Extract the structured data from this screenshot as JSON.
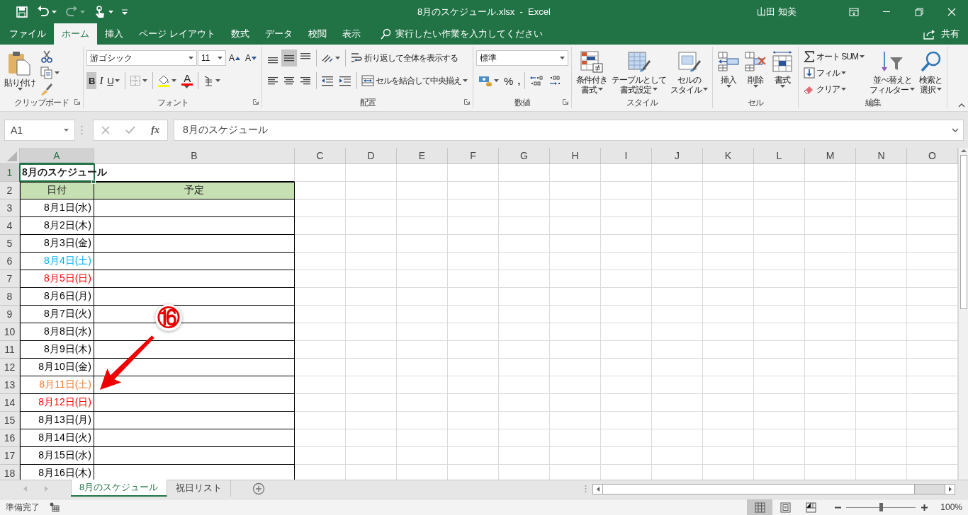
{
  "title_bar": {
    "title": "8月のスケジュール.xlsx  -  Excel",
    "user": "山田 知美"
  },
  "quick_access": [
    {
      "disabled": false
    },
    {
      "disabled": false
    },
    {
      "disabled": true
    },
    {
      "disabled": false
    }
  ],
  "ribbon_tabs": [
    {
      "label": "ファイル",
      "selected": false
    },
    {
      "label": "ホーム",
      "selected": true
    },
    {
      "label": "挿入",
      "selected": false
    },
    {
      "label": "ページ レイアウト",
      "selected": false
    },
    {
      "label": "数式",
      "selected": false
    },
    {
      "label": "データ",
      "selected": false
    },
    {
      "label": "校閲",
      "selected": false
    },
    {
      "label": "表示",
      "selected": false
    }
  ],
  "tell_me": {
    "placeholder": "実行したい作業を入力してください"
  },
  "share": "共有",
  "ribbon_groups": [
    {
      "label": "クリップボード",
      "launcher": true,
      "sections": [
        {
          "kind": "large",
          "lines": [
            "貼り付け"
          ],
          "menu": true
        },
        {
          "kind": "column",
          "items": [
            {
              "kind": "button",
              "menu": false
            },
            {
              "kind": "button",
              "menu": true
            },
            {
              "kind": "button",
              "menu": false
            }
          ]
        }
      ]
    },
    {
      "label": "フォント",
      "launcher": true,
      "sections": [
        {
          "kind": "tiers",
          "tiers": [
            {
              "items": [
                {
                  "kind": "field",
                  "value": "游ゴシック",
                  "menu": true
                },
                {
                  "kind": "field",
                  "value": "11",
                  "menu": true
                },
                {
                  "kind": "button",
                  "label": "A",
                  "menu": false
                },
                {
                  "kind": "button",
                  "label": "A",
                  "menu": false
                }
              ]
            },
            {
              "items": [
                {
                  "kind": "button",
                  "label": "B",
                  "selected": true,
                  "menu": false
                },
                {
                  "kind": "button",
                  "label": "I",
                  "selected": false,
                  "menu": false
                },
                {
                  "kind": "button",
                  "label": "U",
                  "selected": false,
                  "menu": true
                },
                {
                  "kind": "button",
                  "menu": true,
                  "divider_before": true
                },
                {
                  "kind": "button",
                  "menu": true,
                  "divider_before": true
                },
                {
                  "kind": "button",
                  "label": "A",
                  "menu": true
                },
                {
                  "kind": "button",
                  "menu": true,
                  "divider_before": true
                }
              ]
            }
          ]
        }
      ]
    },
    {
      "label": "配置",
      "launcher": true,
      "sections": [
        {
          "kind": "tiers",
          "tiers": [
            {
              "items": [
                {
                  "kind": "button",
                  "selected": false,
                  "menu": false
                },
                {
                  "kind": "button",
                  "selected": true,
                  "menu": false
                },
                {
                  "kind": "button",
                  "selected": false,
                  "menu": false
                },
                {
                  "kind": "button",
                  "menu": true,
                  "divider_before": true
                },
                {
                  "kind": "button",
                  "label": "折り返して全体を表示する",
                  "selected": false,
                  "menu": false,
                  "divider_before": true
                }
              ]
            },
            {
              "items": [
                {
                  "kind": "button",
                  "selected": false,
                  "menu": false
                },
                {
                  "kind": "button",
                  "selected": false,
                  "menu": false
                },
                {
                  "kind": "button",
                  "selected": false,
                  "menu": false
                },
                {
                  "kind": "button",
                  "menu": false,
                  "divider_before": true
                },
                {
                  "kind": "button",
                  "menu": false
                },
                {
                  "kind": "button",
                  "label": "セルを結合して中央揃え",
                  "selected": false,
                  "menu": true,
                  "divider_before": true
                }
              ]
            }
          ]
        }
      ]
    },
    {
      "label": "数値",
      "launcher": true,
      "sections": [
        {
          "kind": "tiers",
          "tiers": [
            {
              "items": [
                {
                  "kind": "field",
                  "value": "標準",
                  "menu": true
                }
              ]
            },
            {
              "items": [
                {
                  "kind": "button",
                  "menu": true
                },
                {
                  "kind": "button",
                  "label": "%",
                  "menu": false
                },
                {
                  "kind": "button",
                  "label": ",",
                  "menu": false
                },
                {
                  "kind": "button",
                  "menu": false,
                  "divider_before": true
                },
                {
                  "kind": "button",
                  "menu": false
                }
              ]
            }
          ]
        }
      ]
    },
    {
      "label": "スタイル",
      "launcher": false,
      "sections": [
        {
          "kind": "large",
          "lines": [
            "条件付き",
            "書式"
          ],
          "menu": true
        },
        {
          "kind": "large",
          "lines": [
            "テーブルとして",
            "書式設定"
          ],
          "menu": true
        },
        {
          "kind": "large",
          "lines": [
            "セルの",
            "スタイル"
          ],
          "menu": true
        }
      ]
    },
    {
      "label": "セル",
      "launcher": false,
      "sections": [
        {
          "kind": "large",
          "lines": [
            "挿入"
          ],
          "menu": true
        },
        {
          "kind": "large",
          "lines": [
            "削除"
          ],
          "menu": true
        },
        {
          "kind": "large",
          "lines": [
            "書式"
          ],
          "menu": true
        }
      ]
    },
    {
      "label": "編集",
      "launcher": false,
      "sections": [
        {
          "kind": "column",
          "items": [
            {
              "kind": "button",
              "label": "オート SUM",
              "menu": true
            },
            {
              "kind": "button",
              "label": "フィル",
              "menu": true
            },
            {
              "kind": "button",
              "label": "クリア",
              "menu": true
            }
          ]
        },
        {
          "kind": "large",
          "lines": [
            "並べ替えと",
            "フィルター"
          ],
          "menu": true
        },
        {
          "kind": "large",
          "lines": [
            "検索と",
            "選択"
          ],
          "menu": true
        }
      ]
    }
  ],
  "formula_bar": {
    "name_box": "A1",
    "function_label": "fx",
    "formula": "8月のスケジュール"
  },
  "columns": [
    {
      "label": "A",
      "selected": true
    },
    {
      "label": "B",
      "selected": false
    },
    {
      "label": "C",
      "selected": false
    },
    {
      "label": "D",
      "selected": false
    },
    {
      "label": "E",
      "selected": false
    },
    {
      "label": "F",
      "selected": false
    },
    {
      "label": "G",
      "selected": false
    },
    {
      "label": "H",
      "selected": false
    },
    {
      "label": "I",
      "selected": false
    },
    {
      "label": "J",
      "selected": false
    },
    {
      "label": "K",
      "selected": false
    },
    {
      "label": "L",
      "selected": false
    },
    {
      "label": "M",
      "selected": false
    },
    {
      "label": "N",
      "selected": false
    },
    {
      "label": "O",
      "selected": false
    }
  ],
  "rows": [
    {
      "number": "1",
      "kind": "title",
      "selected": true,
      "a": "8月のスケジュール"
    },
    {
      "number": "2",
      "kind": "header",
      "selected": false,
      "a": "日付",
      "b": "予定"
    },
    {
      "number": "3",
      "kind": "date",
      "selected": false,
      "a": "8月1日(水)",
      "color": "#000000"
    },
    {
      "number": "4",
      "kind": "date",
      "selected": false,
      "a": "8月2日(木)",
      "color": "#000000"
    },
    {
      "number": "5",
      "kind": "date",
      "selected": false,
      "a": "8月3日(金)",
      "color": "#000000"
    },
    {
      "number": "6",
      "kind": "date",
      "selected": false,
      "a": "8月4日(土)",
      "color": "#00b0f0"
    },
    {
      "number": "7",
      "kind": "date",
      "selected": false,
      "a": "8月5日(日)",
      "color": "#ff0000"
    },
    {
      "number": "8",
      "kind": "date",
      "selected": false,
      "a": "8月6日(月)",
      "color": "#000000"
    },
    {
      "number": "9",
      "kind": "date",
      "selected": false,
      "a": "8月7日(火)",
      "color": "#000000"
    },
    {
      "number": "10",
      "kind": "date",
      "selected": false,
      "a": "8月8日(水)",
      "color": "#000000"
    },
    {
      "number": "11",
      "kind": "date",
      "selected": false,
      "a": "8月9日(木)",
      "color": "#000000"
    },
    {
      "number": "12",
      "kind": "date",
      "selected": false,
      "a": "8月10日(金)",
      "color": "#000000"
    },
    {
      "number": "13",
      "kind": "date",
      "selected": false,
      "a": "8月11日(土)",
      "color": "#ed7d31"
    },
    {
      "number": "14",
      "kind": "date",
      "selected": false,
      "a": "8月12日(日)",
      "color": "#ff0000"
    },
    {
      "number": "15",
      "kind": "date",
      "selected": false,
      "a": "8月13日(月)",
      "color": "#000000"
    },
    {
      "number": "16",
      "kind": "date",
      "selected": false,
      "a": "8月14日(火)",
      "color": "#000000"
    },
    {
      "number": "17",
      "kind": "date",
      "selected": false,
      "a": "8月15日(水)",
      "color": "#000000"
    },
    {
      "number": "18",
      "kind": "date",
      "selected": false,
      "a": "8月16日(木)",
      "color": "#000000"
    }
  ],
  "annotation": {
    "label": "⑯"
  },
  "sheet_tabs": [
    {
      "label": "8月のスケジュール",
      "selected": true
    },
    {
      "label": "祝日リスト",
      "selected": false
    }
  ],
  "status_bar": {
    "status": "準備完了",
    "views": [
      {
        "selected": true
      },
      {
        "selected": false
      },
      {
        "selected": false
      }
    ],
    "zoom": {
      "level": 0.5,
      "reading": "100%"
    }
  }
}
